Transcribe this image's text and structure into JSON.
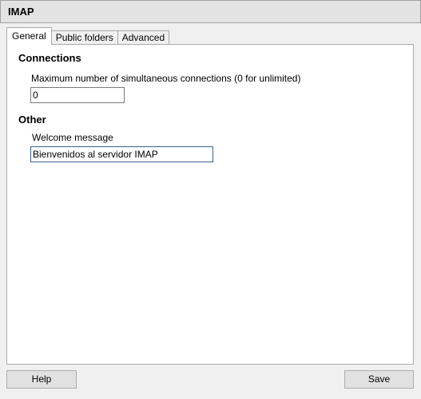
{
  "window": {
    "title": "IMAP"
  },
  "tabs": [
    {
      "label": "General",
      "active": true
    },
    {
      "label": "Public folders",
      "active": false
    },
    {
      "label": "Advanced",
      "active": false
    }
  ],
  "general": {
    "connections": {
      "heading": "Connections",
      "max_connections_label": "Maximum number of simultaneous connections (0 for unlimited)",
      "max_connections_value": "0"
    },
    "other": {
      "heading": "Other",
      "welcome_label": "Welcome message",
      "welcome_value": "Bienvenidos al servidor IMAP"
    }
  },
  "buttons": {
    "help_label": "Help",
    "save_label": "Save"
  }
}
